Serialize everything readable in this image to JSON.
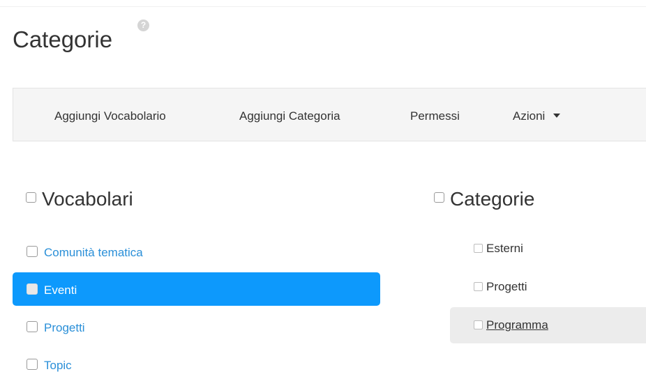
{
  "page": {
    "title": "Categorie",
    "help_icon": "question-mark-icon"
  },
  "toolbar": {
    "items": [
      {
        "label": "Aggiungi Vocabolario"
      },
      {
        "label": "Aggiungi Categoria"
      },
      {
        "label": "Permessi"
      },
      {
        "label": "Azioni",
        "icon": "caret-down-icon"
      }
    ]
  },
  "vocabularies": {
    "heading": "Vocabolari",
    "items": [
      {
        "label": "Comunità tematica",
        "active": false
      },
      {
        "label": "Eventi",
        "active": true
      },
      {
        "label": "Progetti",
        "active": false
      },
      {
        "label": "Topic",
        "active": false
      }
    ]
  },
  "categories": {
    "heading": "Categorie",
    "items": [
      {
        "label": "Esterni",
        "selected": false
      },
      {
        "label": "Progetti",
        "selected": false
      },
      {
        "label": "Programma",
        "selected": true
      }
    ]
  },
  "colors": {
    "link": "#2a8fd8",
    "active_bg": "#0d99fc",
    "selected_bg": "#ececec",
    "toolbar_bg": "#f5f5f5"
  }
}
